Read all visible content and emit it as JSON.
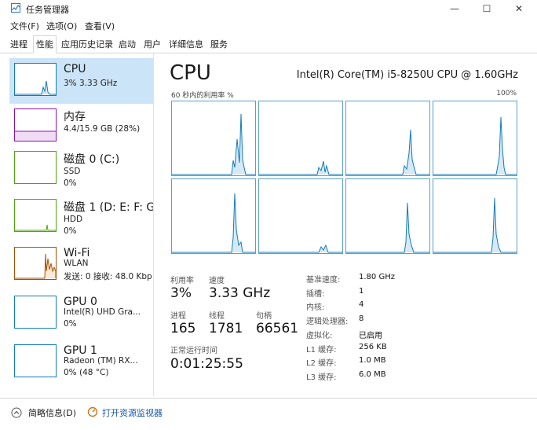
{
  "window": {
    "title": "任务管理器",
    "minimize_glyph": "—",
    "maximize_glyph": "☐",
    "close_glyph": "✕",
    "icon": "task-manager-icon"
  },
  "menu": [
    "文件(F)",
    "选项(O)",
    "查看(V)"
  ],
  "tabs": [
    "进程",
    "性能",
    "应用历史记录",
    "启动",
    "用户",
    "详细信息",
    "服务"
  ],
  "active_tab": "性能",
  "sidebar": {
    "items": [
      {
        "name": "CPU",
        "lines": [
          "3% 3.33 GHz"
        ],
        "color": "#117dbb"
      },
      {
        "name": "内存",
        "lines": [
          "4.4/15.9 GB (28%)"
        ],
        "color": "#8b12ae"
      },
      {
        "name": "磁盘 0 (C:)",
        "lines": [
          "SSD",
          "0%"
        ],
        "color": "#4da60c"
      },
      {
        "name": "磁盘 1 (D: E: F: G:",
        "lines": [
          "HDD",
          "0%"
        ],
        "color": "#4da60c"
      },
      {
        "name": "Wi-Fi",
        "lines": [
          "WLAN",
          "发送: 0 接收: 48.0 Kbp"
        ],
        "color": "#a74f01"
      },
      {
        "name": "GPU 0",
        "lines": [
          "Intel(R) UHD Gra...",
          "0%"
        ],
        "color": "#117dbb"
      },
      {
        "name": "GPU 1",
        "lines": [
          "Radeon (TM) RX...",
          "0% (48 °C)"
        ],
        "color": "#117dbb"
      }
    ]
  },
  "main": {
    "title": "CPU",
    "model": "Intel(R) Core(TM) i5-8250U CPU @ 1.60GHz",
    "graph_left_label": "60 秒内的利用率 %",
    "graph_right_label": "100%",
    "graph_line_color": "#117dbb",
    "graph_fill_color": "#d6e9f5",
    "stats": {
      "utilization_label": "利用率",
      "utilization_value": "3%",
      "speed_label": "速度",
      "speed_value": "3.33 GHz",
      "processes_label": "进程",
      "processes_value": "165",
      "threads_label": "线程",
      "threads_value": "1781",
      "handles_label": "句柄",
      "handles_value": "66561",
      "uptime_label": "正常运行时间",
      "uptime_value": "0:01:25:55"
    },
    "specs": [
      {
        "label": "基准速度:",
        "value": "1.80 GHz"
      },
      {
        "label": "插槽:",
        "value": "1"
      },
      {
        "label": "内核:",
        "value": "4"
      },
      {
        "label": "逻辑处理器:",
        "value": "8"
      },
      {
        "label": "虚拟化:",
        "value": "已启用"
      },
      {
        "label": "L1 缓存:",
        "value": "256 KB"
      },
      {
        "label": "L2 缓存:",
        "value": "1.0 MB"
      },
      {
        "label": "L3 缓存:",
        "value": "6.0 MB"
      }
    ]
  },
  "footer": {
    "summary_label": "简略信息(D)",
    "monitor_label": "打开资源监视器"
  }
}
